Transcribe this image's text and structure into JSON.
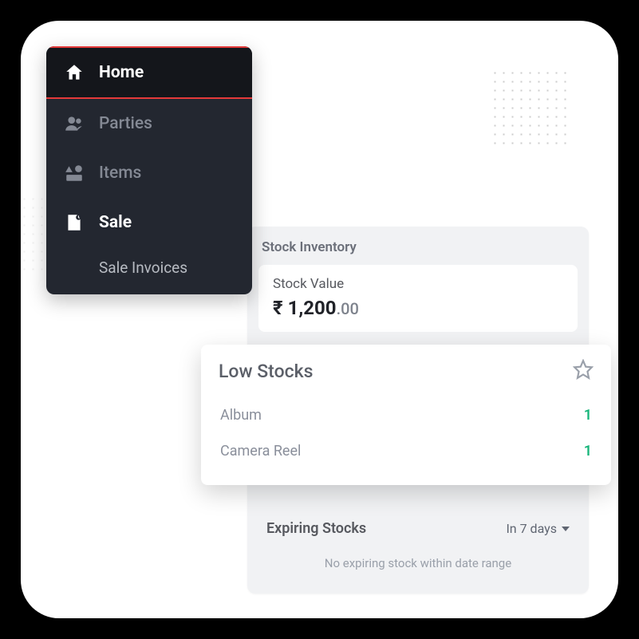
{
  "sidebar": {
    "items": [
      {
        "label": "Home"
      },
      {
        "label": "Parties"
      },
      {
        "label": "Items"
      },
      {
        "label": "Sale"
      }
    ],
    "sale_sub": "Sale Invoices"
  },
  "inventory": {
    "title": "Stock Inventory",
    "stock_value_label": "Stock Value",
    "currency": "₹",
    "amount_main": "1,200",
    "amount_cents": ".00"
  },
  "low_stocks": {
    "title": "Low Stocks",
    "rows": [
      {
        "name": "Album",
        "qty": "1"
      },
      {
        "name": "Camera Reel",
        "qty": "1"
      }
    ]
  },
  "expiring": {
    "title": "Expiring Stocks",
    "range": "In 7 days",
    "empty": "No expiring stock within date range"
  }
}
